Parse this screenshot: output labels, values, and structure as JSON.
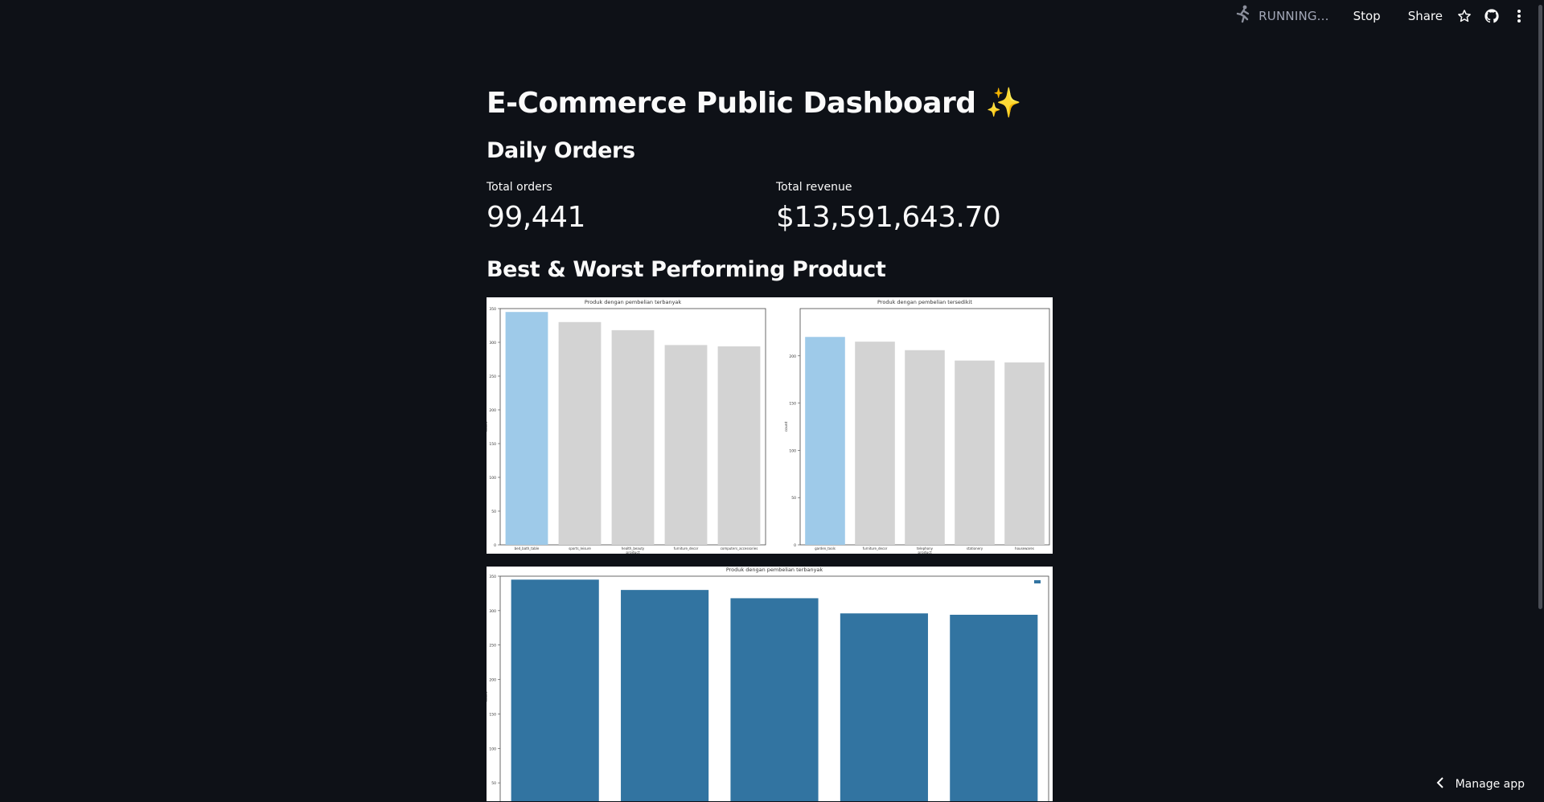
{
  "toolbar": {
    "status_text": "RUNNING...",
    "stop_label": "Stop",
    "share_label": "Share"
  },
  "page": {
    "title": "E-Commerce Public Dashboard ✨"
  },
  "daily_orders": {
    "heading": "Daily Orders",
    "total_orders_label": "Total orders",
    "total_orders_value": "99,441",
    "total_revenue_label": "Total revenue",
    "total_revenue_value": "$13,591,643.70"
  },
  "products": {
    "heading": "Best & Worst Performing Product"
  },
  "footer": {
    "manage_label": "Manage app"
  },
  "colors": {
    "background": "#0e1117",
    "highlight_bar": "#9ecae9",
    "muted_bar": "#d3d3d3",
    "series_bar": "#3274a1"
  },
  "chart_data": [
    {
      "type": "bar",
      "title": "Produk dengan pembelian terbanyak",
      "xlabel": "product",
      "ylabel": "count",
      "categories": [
        "bed_bath_table",
        "sports_leisure",
        "health_beauty",
        "furniture_decor",
        "computers_accessories"
      ],
      "values": [
        345,
        330,
        318,
        296,
        294
      ],
      "ylim": [
        0,
        350
      ],
      "yticks": [
        0,
        50,
        100,
        150,
        200,
        250,
        300,
        350
      ],
      "highlight_index": 0
    },
    {
      "type": "bar",
      "title": "Produk dengan pembelian tersedikit",
      "xlabel": "product",
      "ylabel": "count",
      "categories": [
        "garden_tools",
        "furniture_decor",
        "telephony",
        "stationery",
        "housewares"
      ],
      "values": [
        220,
        215,
        206,
        195,
        193
      ],
      "ylim": [
        0,
        250
      ],
      "yticks": [
        0,
        50,
        100,
        150,
        200
      ],
      "highlight_index": 0
    },
    {
      "type": "bar",
      "title": "Produk dengan pembelian terbanyak",
      "ylabel": "count",
      "categories": [
        "",
        "",
        "",
        "",
        ""
      ],
      "values": [
        345,
        330,
        318,
        296,
        294
      ],
      "ylim": [
        0,
        350
      ],
      "yticks": [
        50,
        100,
        150,
        200,
        250,
        300,
        350
      ],
      "legend": "top-right"
    }
  ]
}
